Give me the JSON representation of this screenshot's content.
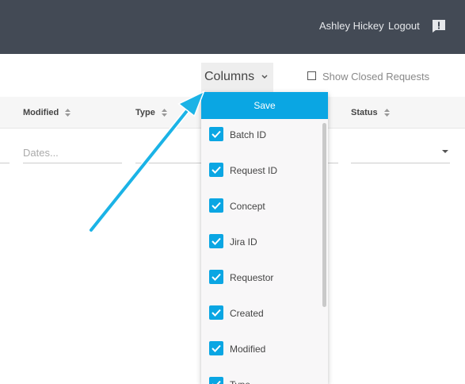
{
  "header": {
    "user_name": "Ashley Hickey",
    "logout_label": "Logout",
    "feedback_icon": "exclamation-bubble-icon",
    "bg_color": "#434a55"
  },
  "toolbar": {
    "columns_label": "Columns",
    "show_closed_label": "Show Closed Requests",
    "show_closed_checked": false
  },
  "table": {
    "headers": [
      "Modified",
      "Type",
      "Status"
    ],
    "filters": {
      "modified_placeholder": "Dates...",
      "status_value": ""
    }
  },
  "columns_dropdown": {
    "save_label": "Save",
    "accent_color": "#0aa6e3",
    "items": [
      {
        "label": "Batch ID",
        "checked": true
      },
      {
        "label": "Request ID",
        "checked": true
      },
      {
        "label": "Concept",
        "checked": true
      },
      {
        "label": "Jira ID",
        "checked": true
      },
      {
        "label": "Requestor",
        "checked": true
      },
      {
        "label": "Created",
        "checked": true
      },
      {
        "label": "Modified",
        "checked": true
      },
      {
        "label": "Type",
        "checked": true
      }
    ]
  },
  "annotation": {
    "arrow_color": "#1bb3e6"
  }
}
